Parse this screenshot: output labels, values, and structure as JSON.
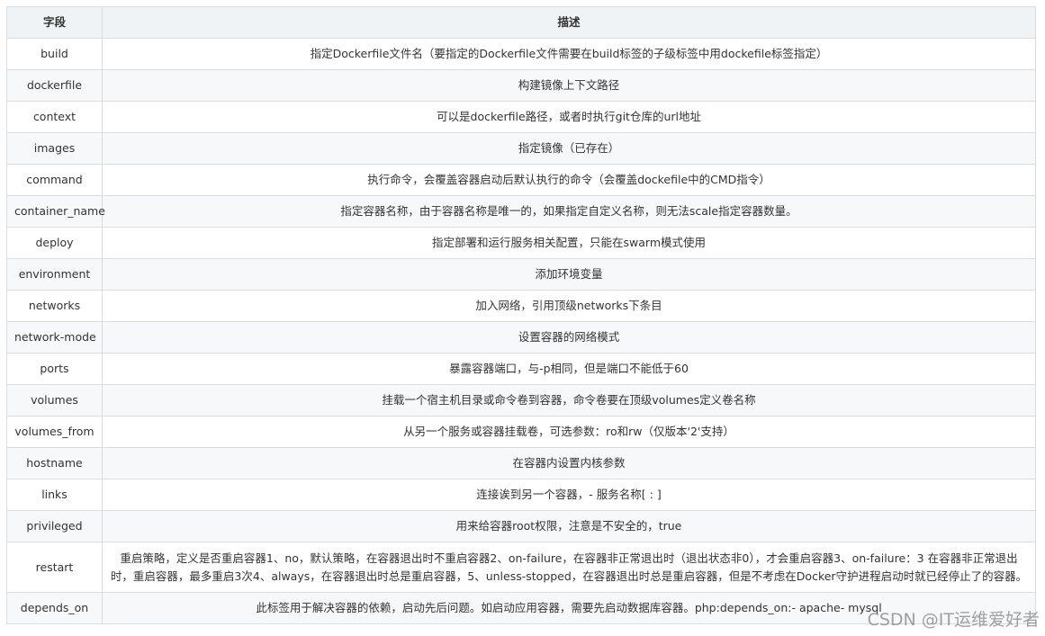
{
  "table": {
    "headers": [
      "字段",
      "描述"
    ],
    "rows": [
      {
        "field": "build",
        "desc": "指定Dockerfile文件名（要指定的Dockerfile文件需要在build标签的子级标签中用dockefile标签指定）"
      },
      {
        "field": "dockerfile",
        "desc": "构建镜像上下文路径"
      },
      {
        "field": "context",
        "desc": "可以是dockerfile路径，或者时执行git仓库的url地址"
      },
      {
        "field": "images",
        "desc": "指定镜像（已存在）"
      },
      {
        "field": "command",
        "desc": "执行命令，会覆盖容器启动后默认执行的命令（会覆盖dockefile中的CMD指令）"
      },
      {
        "field": "container_name",
        "desc": "指定容器名称，由于容器名称是唯一的，如果指定自定义名称，则无法scale指定容器数量。"
      },
      {
        "field": "deploy",
        "desc": "指定部署和运行服务相关配置，只能在swarm模式使用"
      },
      {
        "field": "environment",
        "desc": "添加环境变量"
      },
      {
        "field": "networks",
        "desc": "加入网络，引用顶级networks下条目"
      },
      {
        "field": "network-mode",
        "desc": "设置容器的网络模式"
      },
      {
        "field": "ports",
        "desc": "暴露容器端口，与-p相同，但是端口不能低于60"
      },
      {
        "field": "volumes",
        "desc": "挂载一个宿主机目录或命令卷到容器，命令卷要在顶级volumes定义卷名称"
      },
      {
        "field": "volumes_from",
        "desc": "从另一个服务或容器挂载卷，可选参数：ro和rw（仅版本'2'支持）"
      },
      {
        "field": "hostname",
        "desc": "在容器内设置内核参数"
      },
      {
        "field": "links",
        "desc": "连接诶到另一个容器，- 服务名称[ : ]"
      },
      {
        "field": "privileged",
        "desc": "用来给容器root权限，注意是不安全的，true"
      },
      {
        "field": "restart",
        "desc": "重启策略，定义是否重启容器1、no，默认策略，在容器退出时不重启容器2、on-failure，在容器非正常退出时（退出状态非0），才会重启容器3、on-failure：3 在容器非正常退出时，重启容器，最多重启3次4、always，在容器退出时总是重启容器，5、unless-stopped，在容器退出时总是重启容器，但是不考虑在Docker守护进程启动时就已经停止了的容器。"
      },
      {
        "field": "depends_on",
        "desc": "此标签用于解决容器的依赖，启动先后问题。如启动应用容器，需要先启动数据库容器。php:depends_on:- apache- mysql"
      }
    ]
  },
  "watermark": "CSDN @IT运维爱好者"
}
